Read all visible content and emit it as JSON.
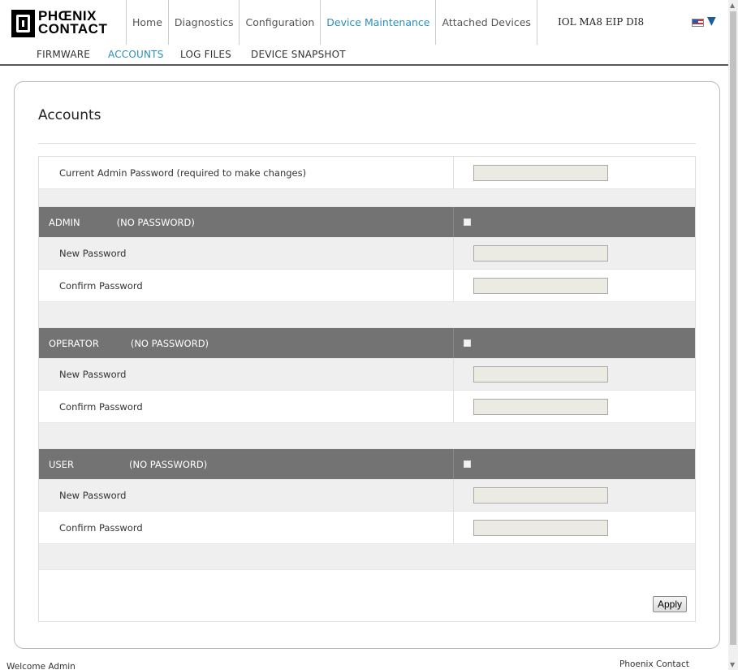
{
  "logo": {
    "line1": "PHŒNIX",
    "line2": "CONTACT"
  },
  "nav": {
    "tabs": [
      {
        "label": "Home"
      },
      {
        "label": "Diagnostics"
      },
      {
        "label": "Configuration"
      },
      {
        "label": "Device Maintenance",
        "active": true
      },
      {
        "label": "Attached Devices"
      }
    ],
    "device_name": "IOL MA8 EIP DI8",
    "flag_arrow": "▼"
  },
  "subnav": {
    "items": [
      {
        "label": "FIRMWARE"
      },
      {
        "label": "ACCOUNTS",
        "active": true
      },
      {
        "label": "LOG FILES"
      },
      {
        "label": "DEVICE SNAPSHOT"
      }
    ]
  },
  "accounts": {
    "title": "Accounts",
    "current_admin_label": "Current Admin Password (required to make changes)",
    "current_admin_value": "",
    "sections": [
      {
        "name": "ADMIN",
        "status": "(NO PASSWORD)",
        "new_label": "New Password",
        "confirm_label": "Confirm Password",
        "new_value": "",
        "confirm_value": ""
      },
      {
        "name": "OPERATOR",
        "status": "(NO PASSWORD)",
        "new_label": "New Password",
        "confirm_label": "Confirm Password",
        "new_value": "",
        "confirm_value": ""
      },
      {
        "name": "USER",
        "status": "(NO PASSWORD)",
        "new_label": "New Password",
        "confirm_label": "Confirm Password",
        "new_value": "",
        "confirm_value": ""
      }
    ],
    "apply_label": "Apply"
  },
  "footer": {
    "welcome": "Welcome Admin",
    "company": "Phoenix Contact"
  },
  "colors": {
    "accent": "#2b8fb8",
    "section_header": "#737373",
    "field_bg": "#ebebe4"
  },
  "icons": {
    "flag": "us-flag-icon",
    "dropdown": "chevron-down-icon"
  }
}
